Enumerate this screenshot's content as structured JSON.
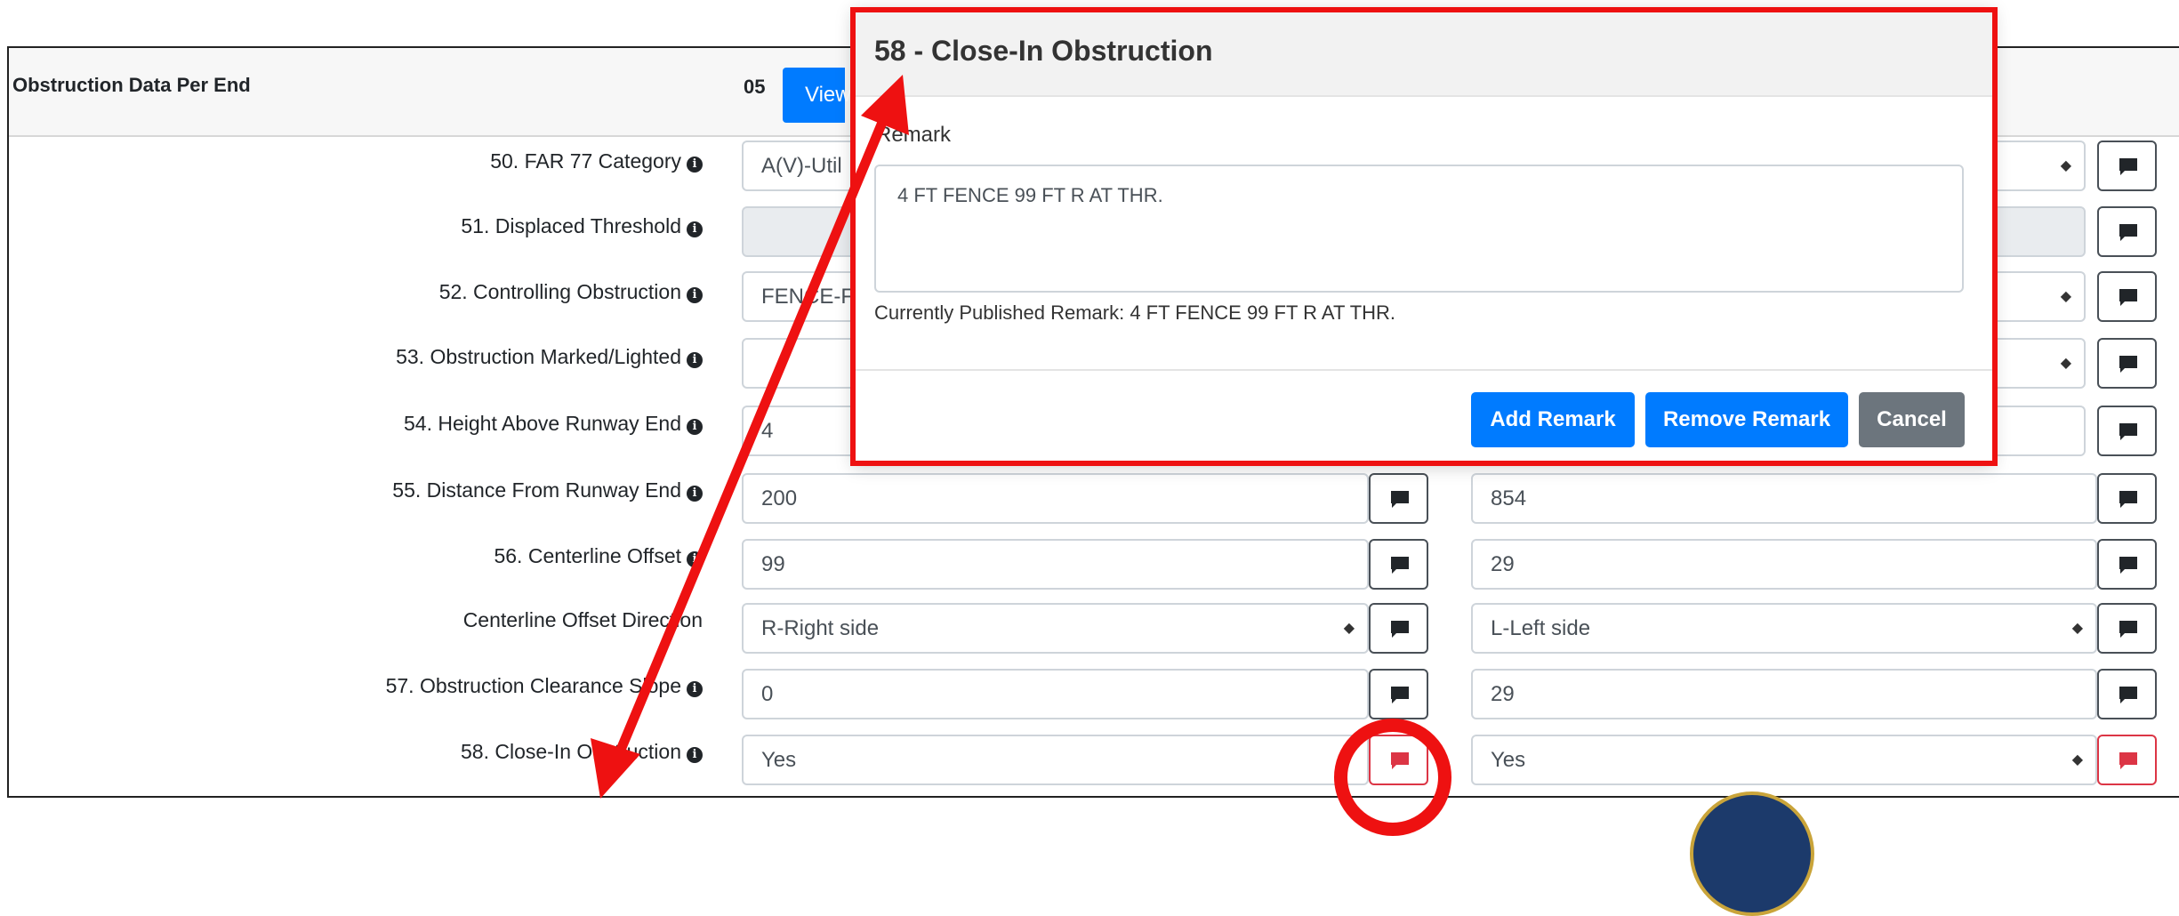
{
  "panel": {
    "title": "Obstruction Data Per End",
    "end_label": "05",
    "view_button": "View"
  },
  "rows": [
    {
      "label": "50. FAR 77 Category",
      "info": true,
      "left": "A(V)-Util",
      "right": ""
    },
    {
      "label": "51. Displaced Threshold",
      "info": true,
      "left": "",
      "right": ""
    },
    {
      "label": "52. Controlling Obstruction",
      "info": true,
      "left": "FENCE-Fe",
      "right": ""
    },
    {
      "label": "53. Obstruction Marked/Lighted",
      "info": true,
      "left": "",
      "right": ""
    },
    {
      "label": "54. Height Above Runway End",
      "info": true,
      "left": "4",
      "right": ""
    },
    {
      "label": "55. Distance From Runway End",
      "info": true,
      "left": "200",
      "right": "854"
    },
    {
      "label": "56. Centerline Offset",
      "info": true,
      "left": "99",
      "right": "29"
    },
    {
      "label": "Centerline Offset Direction",
      "info": false,
      "left": "R-Right side",
      "right": "L-Left side"
    },
    {
      "label": "57. Obstruction Clearance Slope",
      "info": true,
      "left": "0",
      "right": "29"
    },
    {
      "label": "58. Close-In Obstruction",
      "info": true,
      "left": "Yes",
      "right": "Yes"
    }
  ],
  "modal": {
    "title": "58 - Close-In Obstruction",
    "remark_label": "Remark",
    "remark_value": "4 FT FENCE 99 FT R AT THR.",
    "published_remark": "Currently Published Remark: 4 FT FENCE 99 FT R AT THR.",
    "add_button": "Add Remark",
    "remove_button": "Remove Remark",
    "cancel_button": "Cancel"
  },
  "colors": {
    "primary": "#007bff",
    "secondary": "#6c757d",
    "danger": "#dc3545",
    "annotation": "#ee1111"
  },
  "icons": {
    "comment": "comment-icon",
    "info": "info-icon",
    "caret": "sort-caret-icon"
  }
}
